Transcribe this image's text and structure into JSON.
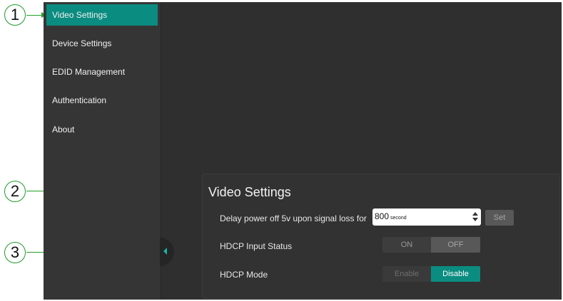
{
  "callouts": {
    "one": "1",
    "two": "2",
    "three": "3"
  },
  "sidebar": {
    "items": [
      {
        "label": "Video Settings",
        "active": true
      },
      {
        "label": "Device Settings"
      },
      {
        "label": "EDID Management"
      },
      {
        "label": "Authentication"
      },
      {
        "label": "About"
      }
    ]
  },
  "panel": {
    "title": "Video Settings",
    "delay": {
      "label": "Delay power off 5v upon signal loss for",
      "value": "800",
      "unit": "second",
      "button": "Set"
    },
    "hdcp_input": {
      "label": "HDCP Input Status",
      "options": [
        "ON",
        "OFF"
      ],
      "selected": "OFF"
    },
    "hdcp_mode": {
      "label": "HDCP Mode",
      "options": [
        "Enable",
        "Disable"
      ],
      "selected": "Disable"
    }
  },
  "colors": {
    "accent": "#0b8c80",
    "callout_green": "#1f9a2b",
    "background": "#2f2f2f"
  },
  "icons": {
    "collapse": "chevron-left-icon",
    "spinner": "up-down-spinner-icon"
  }
}
